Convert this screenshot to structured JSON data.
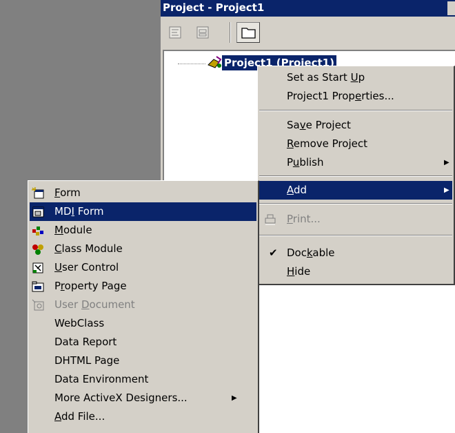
{
  "window": {
    "title": "Project - Project1"
  },
  "tree": {
    "root_label": "Project1 (Project1)"
  },
  "context_menu": {
    "items": [
      {
        "label": "Set as Start Up",
        "u": "U",
        "pre": "Set as Start ",
        "post": "p"
      },
      {
        "label": "Project1 Properties...",
        "pre": "Project1 Prop",
        "u": "e",
        "post": "rties..."
      },
      {
        "label": "Save Project",
        "pre": "Sa",
        "u": "v",
        "post": "e Project"
      },
      {
        "label": "Remove Project",
        "pre": "",
        "u": "R",
        "post": "emove Project"
      },
      {
        "label": "Publish",
        "pre": "P",
        "u": "u",
        "post": "blish"
      },
      {
        "label": "Add",
        "pre": "",
        "u": "A",
        "post": "dd"
      },
      {
        "label": "Print...",
        "pre": "",
        "u": "P",
        "post": "rint..."
      },
      {
        "label": "Dockable",
        "pre": "Doc",
        "u": "k",
        "post": "able"
      },
      {
        "label": "Hide",
        "pre": "",
        "u": "H",
        "post": "ide"
      }
    ],
    "checked_item": "Dockable",
    "highlighted_item": "Add",
    "disabled_item": "Print..."
  },
  "add_menu": {
    "items": [
      {
        "label": "Form",
        "pre": "",
        "u": "F",
        "post": "orm",
        "icon": "form-icon"
      },
      {
        "label": "MDI Form",
        "pre": "MD",
        "u": "I",
        "post": " Form",
        "icon": "mdi-form-icon"
      },
      {
        "label": "Module",
        "pre": "",
        "u": "M",
        "post": "odule",
        "icon": "module-icon"
      },
      {
        "label": "Class Module",
        "pre": "",
        "u": "C",
        "post": "lass Module",
        "icon": "class-module-icon"
      },
      {
        "label": "User Control",
        "pre": "",
        "u": "U",
        "post": "ser Control",
        "icon": "user-control-icon"
      },
      {
        "label": "Property Page",
        "pre": "P",
        "u": "r",
        "post": "operty Page",
        "icon": "property-page-icon"
      },
      {
        "label": "User Document",
        "pre": "User ",
        "u": "D",
        "post": "ocument",
        "icon": "user-document-icon"
      },
      {
        "label": "WebClass",
        "pre": "WebClass",
        "u": "",
        "post": ""
      },
      {
        "label": "Data Report",
        "pre": "Data Report",
        "u": "",
        "post": ""
      },
      {
        "label": "DHTML Page",
        "pre": "DHTML Page",
        "u": "",
        "post": ""
      },
      {
        "label": "Data Environment",
        "pre": "Data Environment",
        "u": "",
        "post": ""
      },
      {
        "label": "More ActiveX Designers...",
        "pre": "More ActiveX Designers...",
        "u": "",
        "post": ""
      },
      {
        "label": "Add File...",
        "pre": "",
        "u": "A",
        "post": "dd File..."
      }
    ],
    "highlighted_item": "MDI Form",
    "disabled_item": "User Document"
  },
  "colors": {
    "highlight": "#0a246a",
    "menu_bg": "#d4d0c8",
    "disabled": "#808080",
    "desktop": "#808080"
  }
}
